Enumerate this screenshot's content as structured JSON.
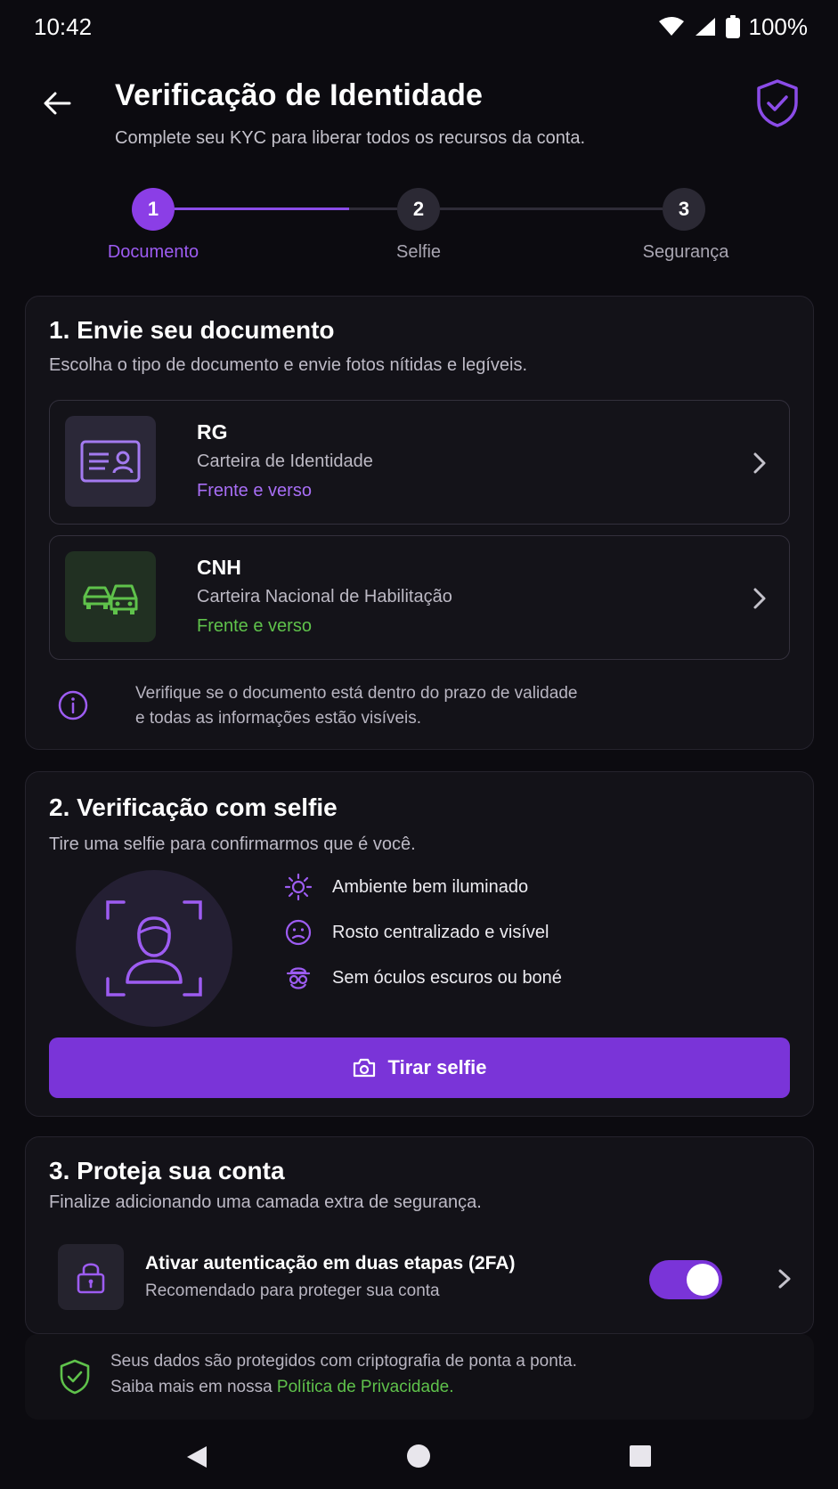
{
  "status_bar": {
    "time": "10:42",
    "battery": "100%"
  },
  "header": {
    "title": "Verificação de Identidade",
    "subtitle": "Complete seu KYC para liberar todos os recursos da conta."
  },
  "stepper": {
    "steps": [
      {
        "number": "1",
        "label": "Documento"
      },
      {
        "number": "2",
        "label": "Selfie"
      },
      {
        "number": "3",
        "label": "Segurança"
      }
    ],
    "current_step": 1,
    "progress_to_step2": 0.63
  },
  "document_section": {
    "title": "1. Envie seu documento",
    "description": "Escolha o tipo de documento e envie fotos nítidas e legíveis.",
    "options": [
      {
        "name": "RG",
        "full_name": "Carteira de Identidade",
        "note": "Frente e verso",
        "icon": "id-card-icon"
      },
      {
        "name": "CNH",
        "full_name": "Carteira Nacional de Habilitação",
        "note": "Frente e verso",
        "icon": "cars-icon"
      }
    ],
    "info_line1": "Verifique se o documento está dentro do prazo de validade",
    "info_line2": "e todas as informações estão visíveis."
  },
  "selfie_section": {
    "title": "2. Verificação com selfie",
    "description": "Tire uma selfie para confirmarmos que é você.",
    "tips": [
      {
        "text": "Ambiente bem iluminado",
        "icon": "sun-icon"
      },
      {
        "text": "Rosto centralizado e visível",
        "icon": "face-icon"
      },
      {
        "text": "Sem óculos escuros ou boné",
        "icon": "glasses-cap-icon"
      }
    ],
    "button_label": "Tirar selfie"
  },
  "security_section": {
    "title": "3. Proteja sua conta",
    "description": "Finalize adicionando uma camada extra de segurança.",
    "twofa_title": "Ativar autenticação em duas etapas (2FA)",
    "twofa_desc": "Recomendado para proteger sua conta",
    "twofa_enabled": true
  },
  "footer": {
    "line1": "Seus dados são protegidos com criptografia de ponta a ponta.",
    "line2_prefix": "Saiba mais em nossa ",
    "link": "Política de Privacidade."
  },
  "colors": {
    "accent": "#8b3ee6",
    "success": "#5fc24b",
    "background": "#0c0b10",
    "card": "#131218"
  }
}
